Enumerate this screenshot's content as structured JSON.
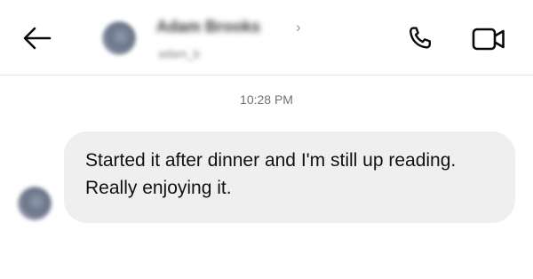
{
  "header": {
    "contact_name": "Adam Brooks",
    "chevron": "›",
    "username": "adam_b",
    "back_icon": "arrow-left-icon",
    "call_icon": "phone-icon",
    "video_icon": "video-camera-icon"
  },
  "thread": {
    "timestamp": "10:28 PM",
    "messages": [
      {
        "text": "Started it after dinner and I'm still up reading. Really enjoying it."
      }
    ]
  },
  "colors": {
    "bubble_background": "#efeff0",
    "divider": "#e6e6e6",
    "timestamp_text": "#737373",
    "icon": "#0a0a0a"
  }
}
